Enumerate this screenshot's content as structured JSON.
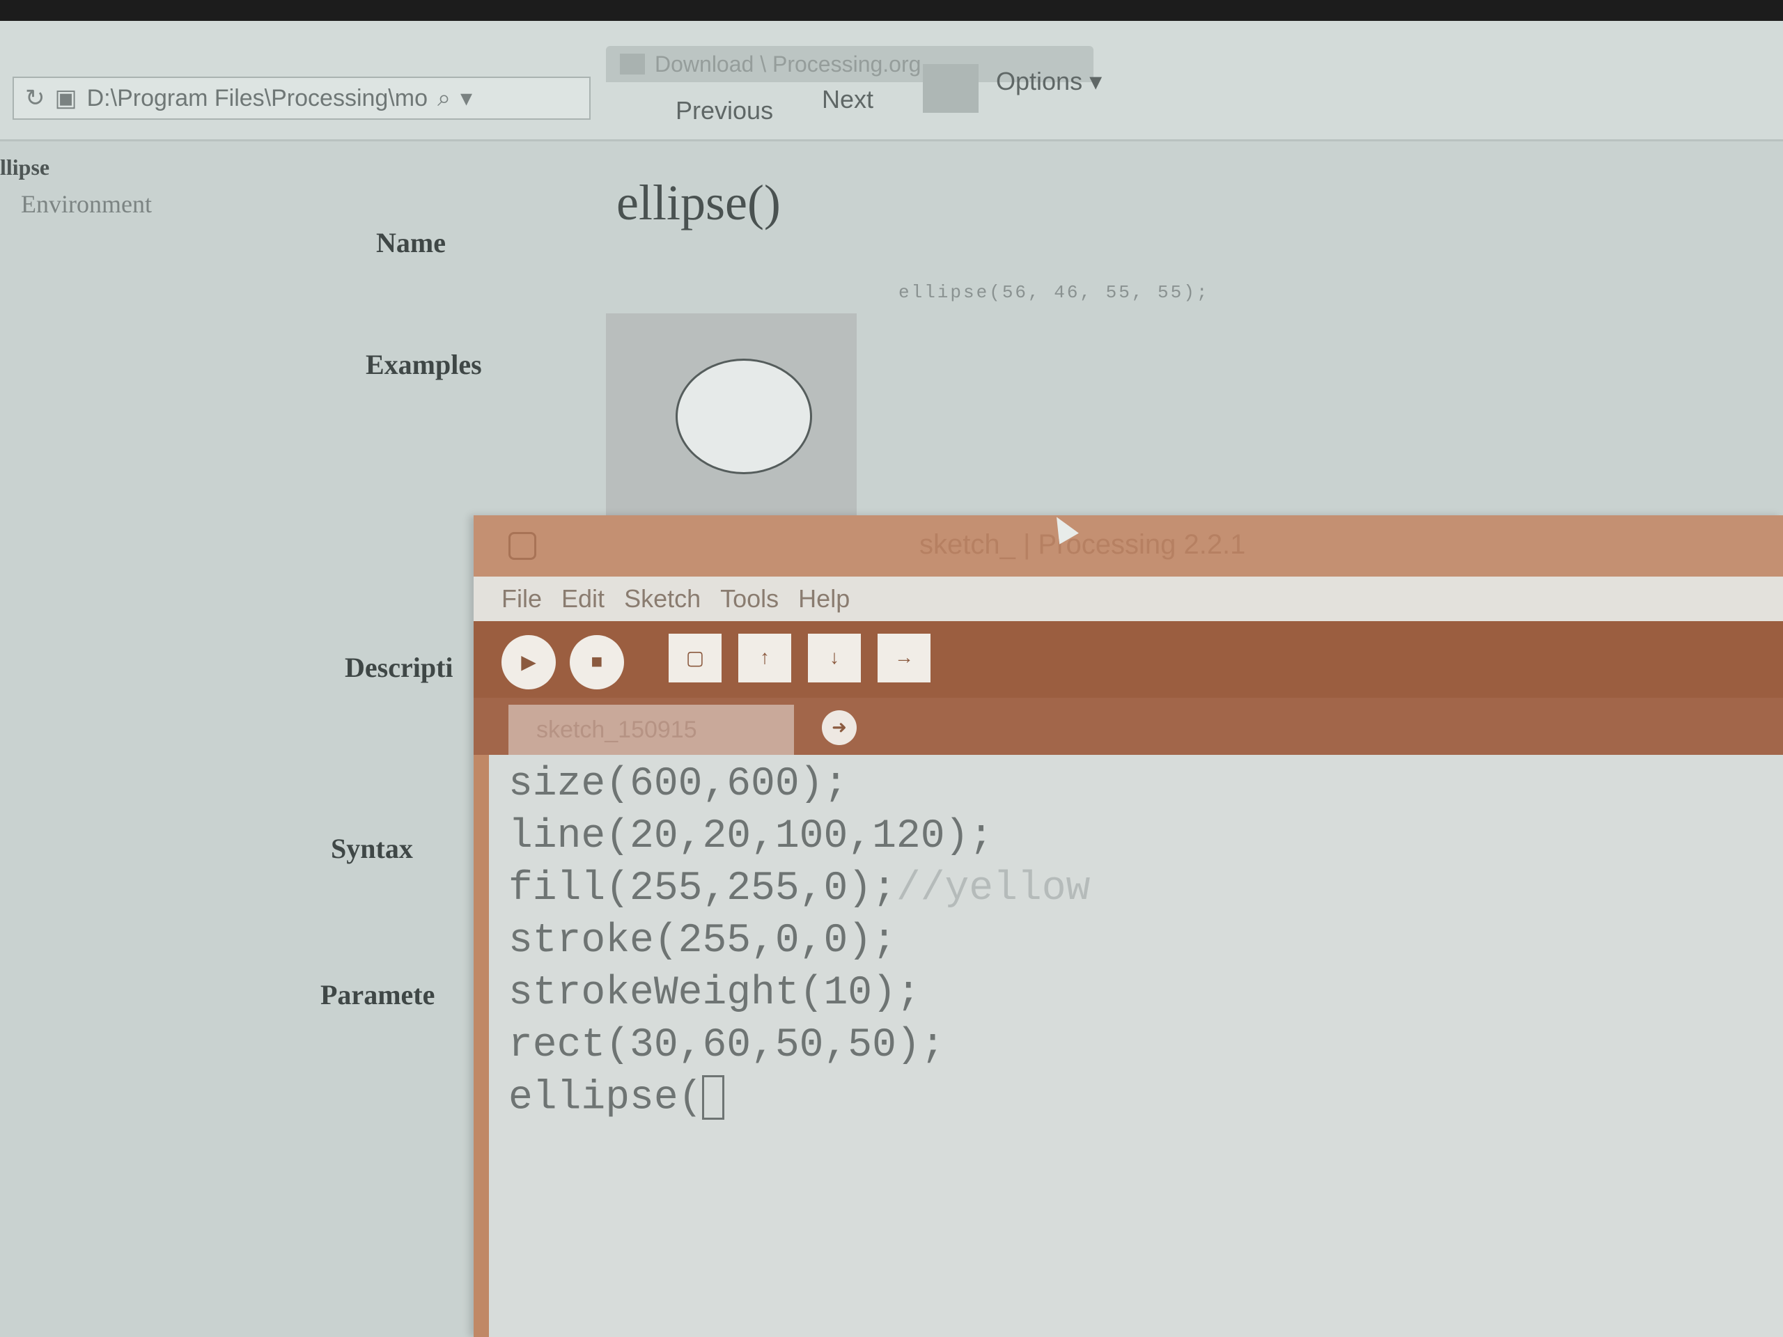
{
  "browser": {
    "address": "D:\\Program Files\\Processing\\mo",
    "tab_title": "Download \\ Processing.org",
    "previous_label": "Previous",
    "next_label": "Next",
    "options_label": "Options"
  },
  "reference": {
    "page_fragment": "llipse",
    "environment_link": "Environment",
    "labels": {
      "name": "Name",
      "examples": "Examples",
      "description": "Descripti",
      "syntax": "Syntax",
      "parameters": "Paramete"
    },
    "title": "ellipse()",
    "example_code": "ellipse(56, 46, 55, 55);"
  },
  "ide": {
    "window_title": "sketch_ | Processing 2.2.1",
    "menus": [
      "File",
      "Edit",
      "Sketch",
      "Tools",
      "Help"
    ],
    "toolbar": {
      "run_icon": "▶",
      "stop_icon": "■",
      "new_icon": "▢",
      "open_icon": "↑",
      "save_icon": "↓",
      "export_icon": "→"
    },
    "sketch_tab": "sketch_150915",
    "tab_menu_icon": "➜",
    "code": [
      {
        "text": "size(600,600);",
        "comment": ""
      },
      {
        "text": "line(20,20,100,120);",
        "comment": ""
      },
      {
        "text": "fill(255,255,0);",
        "comment": "//yellow"
      },
      {
        "text": "stroke(255,0,0);",
        "comment": ""
      },
      {
        "text": "strokeWeight(10);",
        "comment": ""
      },
      {
        "text": "rect(30,60,50,50);",
        "comment": ""
      },
      {
        "text": "ellipse(",
        "comment": ""
      }
    ]
  },
  "colors": {
    "ide_accent": "#9b5e40",
    "editor_bg": "#d7dcda",
    "page_bg": "#c9d2d0"
  }
}
